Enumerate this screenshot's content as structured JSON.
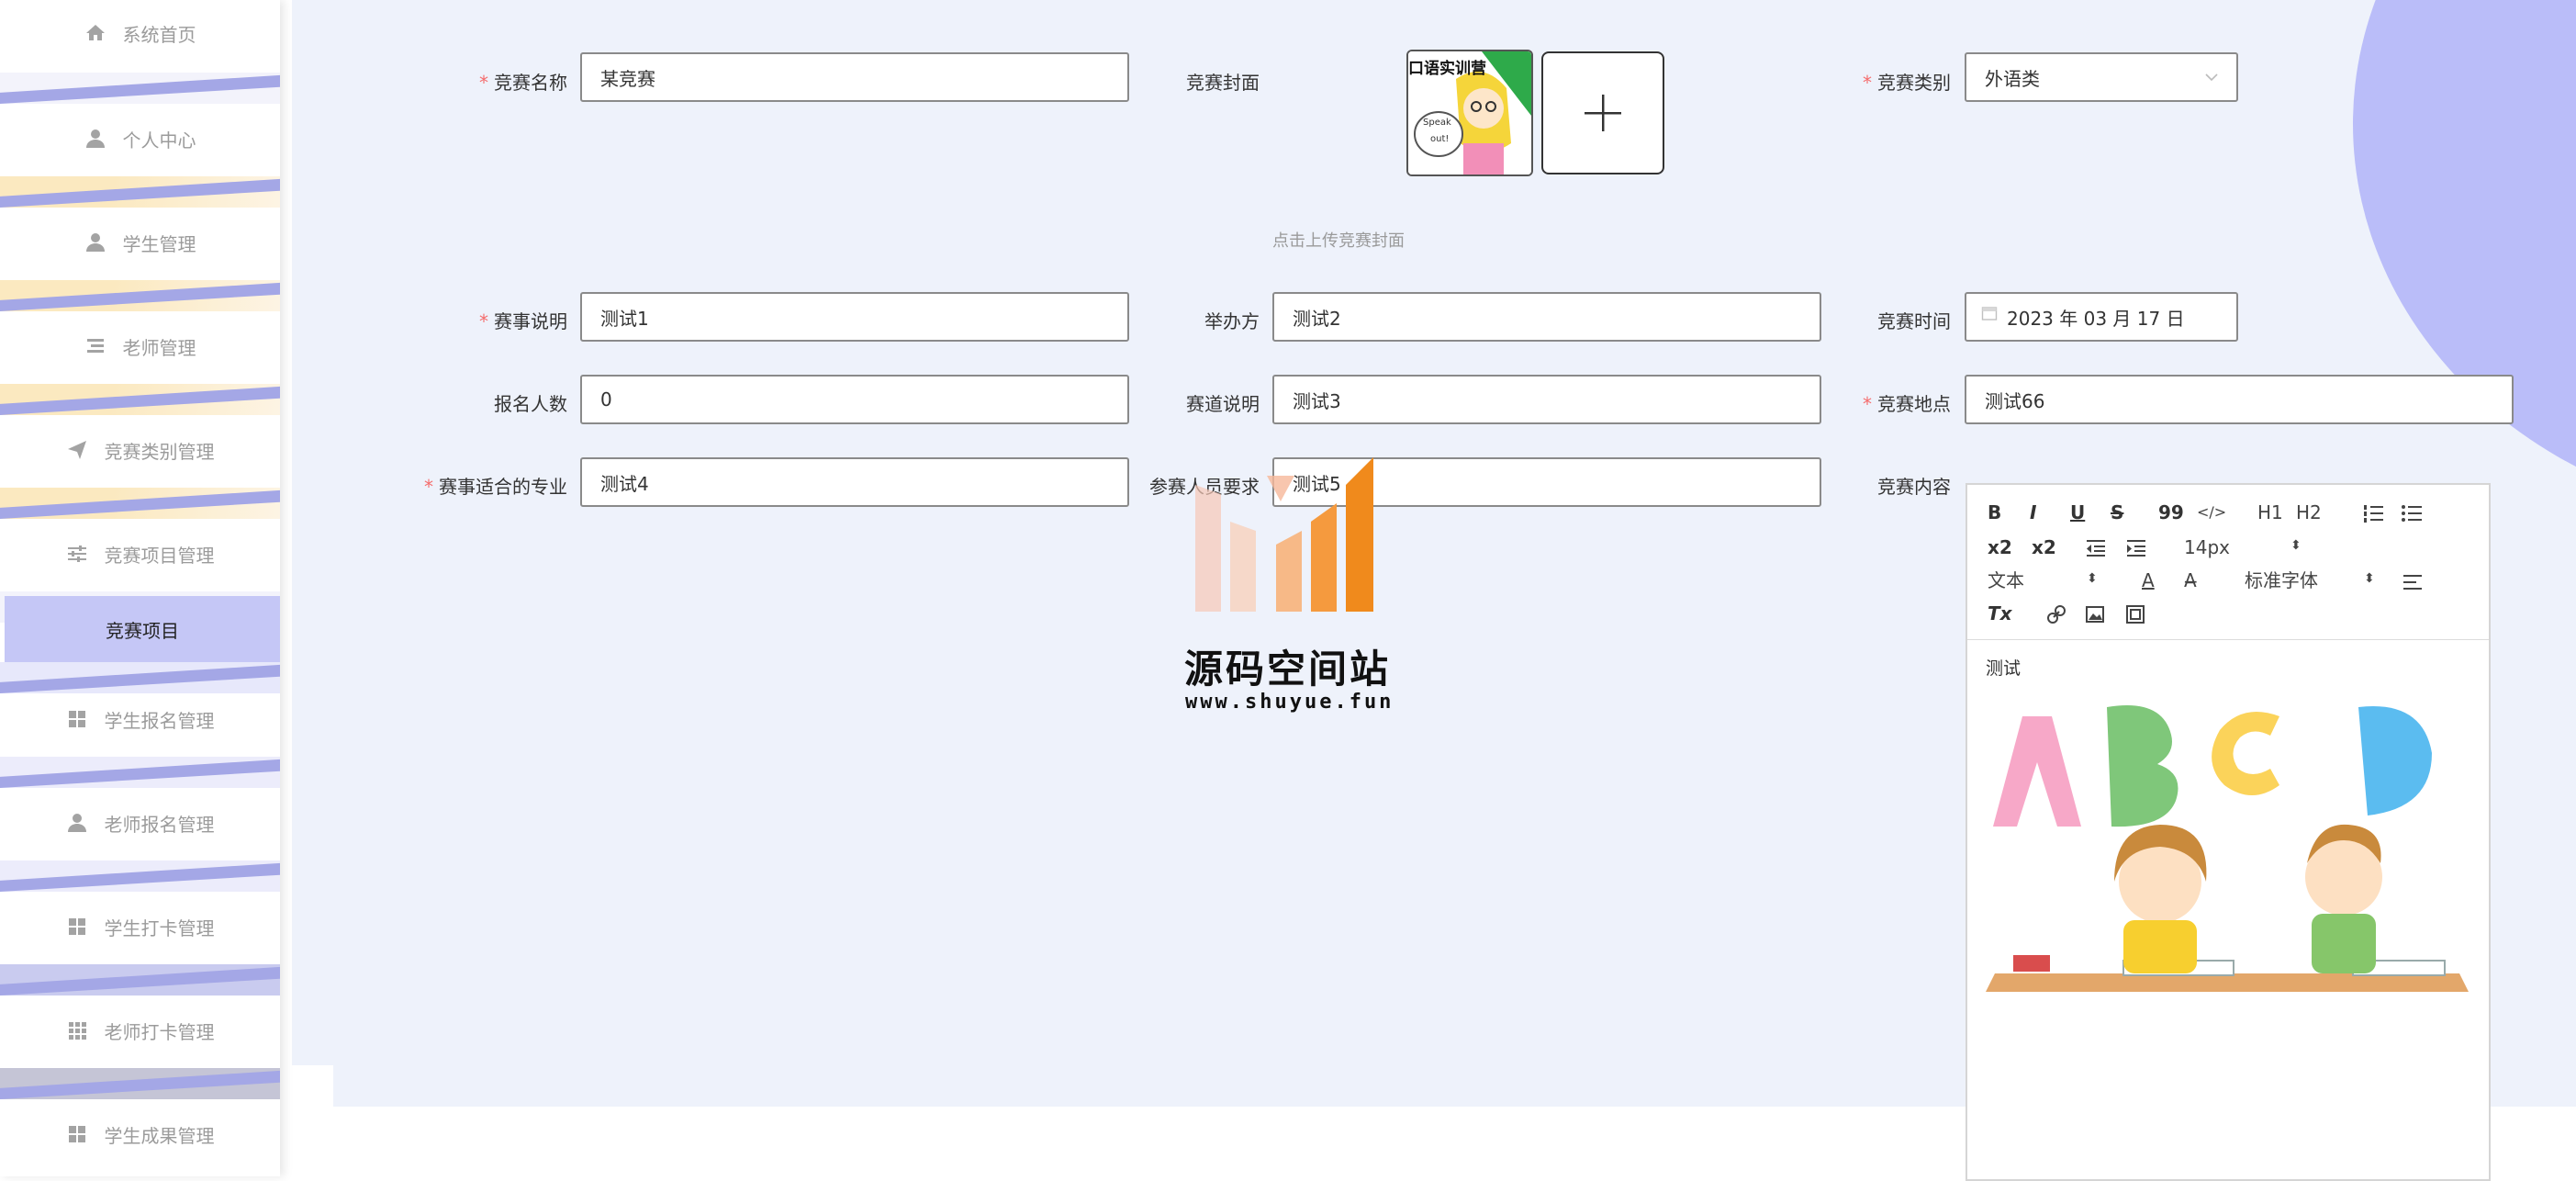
{
  "sidebar": {
    "items": [
      {
        "label": "系统首页",
        "icon": "home-icon"
      },
      {
        "label": "个人中心",
        "icon": "user-icon"
      },
      {
        "label": "学生管理",
        "icon": "user-icon"
      },
      {
        "label": "老师管理",
        "icon": "list-icon"
      },
      {
        "label": "竞赛类别管理",
        "icon": "send-icon"
      },
      {
        "label": "竞赛项目管理",
        "icon": "sliders-icon"
      },
      {
        "label": "学生报名管理",
        "icon": "grid-icon"
      },
      {
        "label": "老师报名管理",
        "icon": "user-icon"
      },
      {
        "label": "学生打卡管理",
        "icon": "grid-icon"
      },
      {
        "label": "老师打卡管理",
        "icon": "apps-icon"
      },
      {
        "label": "学生成果管理",
        "icon": "grid-icon"
      }
    ],
    "active_sub": "竞赛项目"
  },
  "form": {
    "name_label": "竞赛名称",
    "name_value": "某竞赛",
    "cover_label": "竞赛封面",
    "cover_hint": "点击上传竞赛封面",
    "category_label": "竞赛类别",
    "category_value": "外语类",
    "desc_label": "赛事说明",
    "desc_value": "测试1",
    "organizer_label": "举办方",
    "organizer_value": "测试2",
    "time_label": "竞赛时间",
    "time_value": "2023 年 03 月 17 日",
    "count_label": "报名人数",
    "count_value": "0",
    "track_label": "赛道说明",
    "track_value": "测试3",
    "location_label": "竞赛地点",
    "location_value": "测试66",
    "major_label": "赛事适合的专业",
    "major_value": "测试4",
    "participant_label": "参赛人员要求",
    "participant_value": "测试5",
    "content_label": "竞赛内容"
  },
  "editor": {
    "toolbar": {
      "bold": "B",
      "italic": "I",
      "underline": "U",
      "strike": "S",
      "quote": "99",
      "code": "</>",
      "h1": "H1",
      "h2": "H2",
      "sub": "x2",
      "sup": "x2",
      "size": "14px",
      "format": "文本",
      "color": "A",
      "font": "标准字体",
      "clear": "Tx"
    },
    "content_text": "测试"
  },
  "cover_text": {
    "top": "口语实训营",
    "bubble_1": "Speak",
    "bubble_2": "out!"
  },
  "watermark": {
    "title": "源码空间站",
    "url": "www.shuyue.fun"
  },
  "colors": {
    "accent": "#babdf9",
    "active_bg": "#c5c7f6",
    "required": "#f56c6c",
    "page_bg": "#eef2fb"
  }
}
